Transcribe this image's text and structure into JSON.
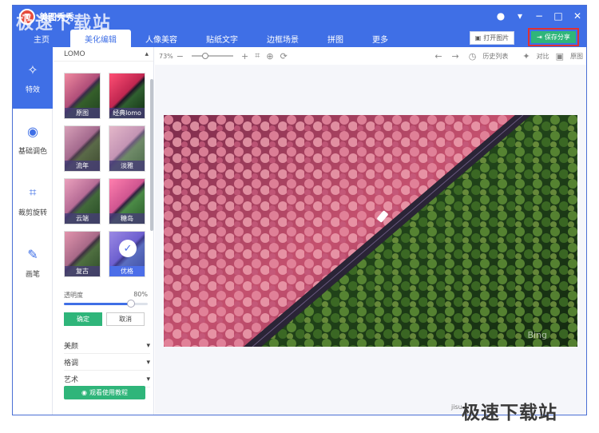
{
  "app": {
    "title": "美图秀秀",
    "logo_letter": "T"
  },
  "window_controls": [
    "chat-icon",
    "dropdown-icon",
    "minimize-icon",
    "maximize-icon",
    "close-icon"
  ],
  "tabs": [
    {
      "label": "主页",
      "active": false
    },
    {
      "label": "美化编辑",
      "active": true
    },
    {
      "label": "人像美容",
      "active": false
    },
    {
      "label": "贴纸文字",
      "active": false
    },
    {
      "label": "边框场景",
      "active": false
    },
    {
      "label": "拼图",
      "active": false
    },
    {
      "label": "更多",
      "active": false
    }
  ],
  "header_buttons": {
    "open_label": "打开图片",
    "save_label": "保存分享"
  },
  "rail": [
    {
      "label": "特效",
      "icon": "magic-wand-icon",
      "active": true
    },
    {
      "label": "基础调色",
      "icon": "palette-icon",
      "active": false
    },
    {
      "label": "裁剪旋转",
      "icon": "crop-icon",
      "active": false
    },
    {
      "label": "画笔",
      "icon": "brush-icon",
      "active": false
    }
  ],
  "panel": {
    "title": "LOMO",
    "filters": [
      {
        "label": "原图",
        "style": ""
      },
      {
        "label": "经典lomo",
        "style": "lomo"
      },
      {
        "label": "流年",
        "style": "old"
      },
      {
        "label": "淡雅",
        "style": "light"
      },
      {
        "label": "云端",
        "style": "cloud"
      },
      {
        "label": "糖岛",
        "style": "candy"
      },
      {
        "label": "复古",
        "style": "retro"
      },
      {
        "label": "优格",
        "style": "best",
        "selected": true
      }
    ],
    "opacity_label": "透明度",
    "opacity_value": "80%",
    "opacity_fraction": 0.8,
    "ok_label": "确定",
    "cancel_label": "取消",
    "categories": [
      "美颜",
      "格调",
      "艺术"
    ],
    "tutorial_label": "观看使用教程"
  },
  "toolbar": {
    "zoom": "73%",
    "history_label": "历史列表",
    "compare_label": "对比",
    "original_label": "原图"
  },
  "canvas": {
    "bing_mark": "Bing"
  },
  "watermarks": {
    "top_left": "极速下载站",
    "bottom_right": "极速下载站",
    "bottom_right_small": "jisu"
  },
  "colors": {
    "brand_blue": "#3f6fe6",
    "save_green": "#2fb57a",
    "highlight_red": "#e03131"
  }
}
